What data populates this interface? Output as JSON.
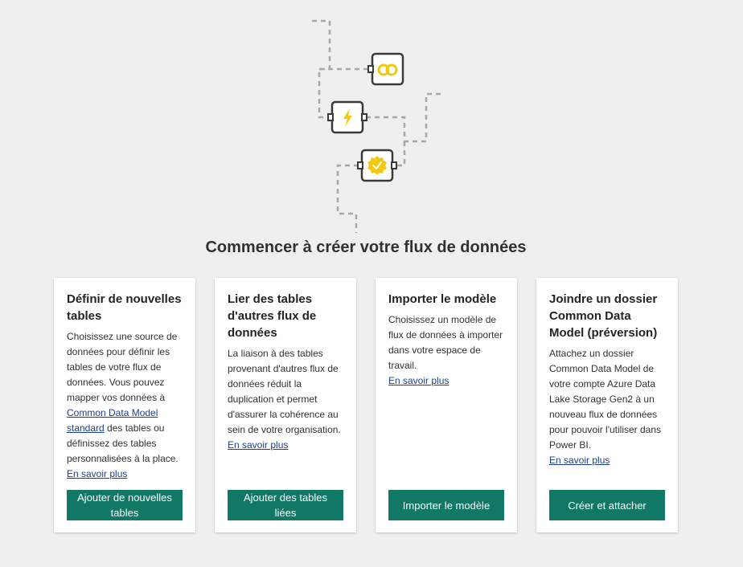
{
  "page": {
    "title": "Commencer à créer votre flux de données"
  },
  "cards": [
    {
      "title": "Définir de nouvelles tables",
      "desc_pre": "Choisissez une source de données pour définir les tables de votre flux de données. Vous pouvez mapper vos données à ",
      "desc_link": "Common Data Model standard",
      "desc_post": " des tables ou définissez des tables personnalisées à la place.",
      "learn_more": "En savoir plus",
      "button": "Ajouter de nouvelles tables"
    },
    {
      "title": "Lier des tables d'autres flux de données",
      "desc": "La liaison à des tables provenant d'autres flux de données réduit la duplication et permet d'assurer la cohérence au sein de votre organisation.",
      "learn_more": "En savoir plus",
      "button": "Ajouter des tables liées"
    },
    {
      "title": "Importer le modèle",
      "desc": "Choisissez un modèle de flux de données à importer dans votre espace de travail.",
      "learn_more": "En savoir plus",
      "button": "Importer le modèle"
    },
    {
      "title": "Joindre un dossier Common Data Model (préversion)",
      "desc": "Attachez un dossier Common Data Model de votre compte Azure Data Lake Storage Gen2 à un nouveau flux de données pour pouvoir l'utiliser dans Power BI.",
      "learn_more": "En savoir plus",
      "button": "Créer et attacher"
    }
  ],
  "illustration": {
    "icons": [
      "link-rings-icon",
      "lightning-icon",
      "verified-badge-icon"
    ],
    "colors": {
      "accent_yellow": "#f2c811",
      "node_border": "#3b3a39",
      "connector": "#a8a8a8"
    }
  },
  "colors": {
    "background": "#efefef",
    "button": "#117865",
    "link": "#1d3f8a"
  }
}
